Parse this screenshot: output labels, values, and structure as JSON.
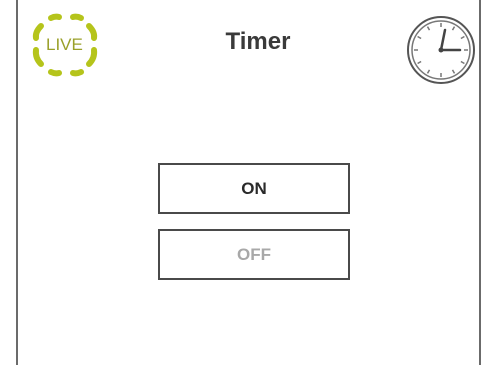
{
  "header": {
    "logo_text": "LIVE",
    "title": "Timer",
    "clock_icon": "clock-icon"
  },
  "controls": {
    "on_label": "ON",
    "off_label": "OFF",
    "selected": "ON"
  },
  "colors": {
    "logo_green": "#b5c41b",
    "title_text": "#3a3a3a",
    "button_border": "#4a4a4a",
    "off_text": "#a8a8a8"
  }
}
